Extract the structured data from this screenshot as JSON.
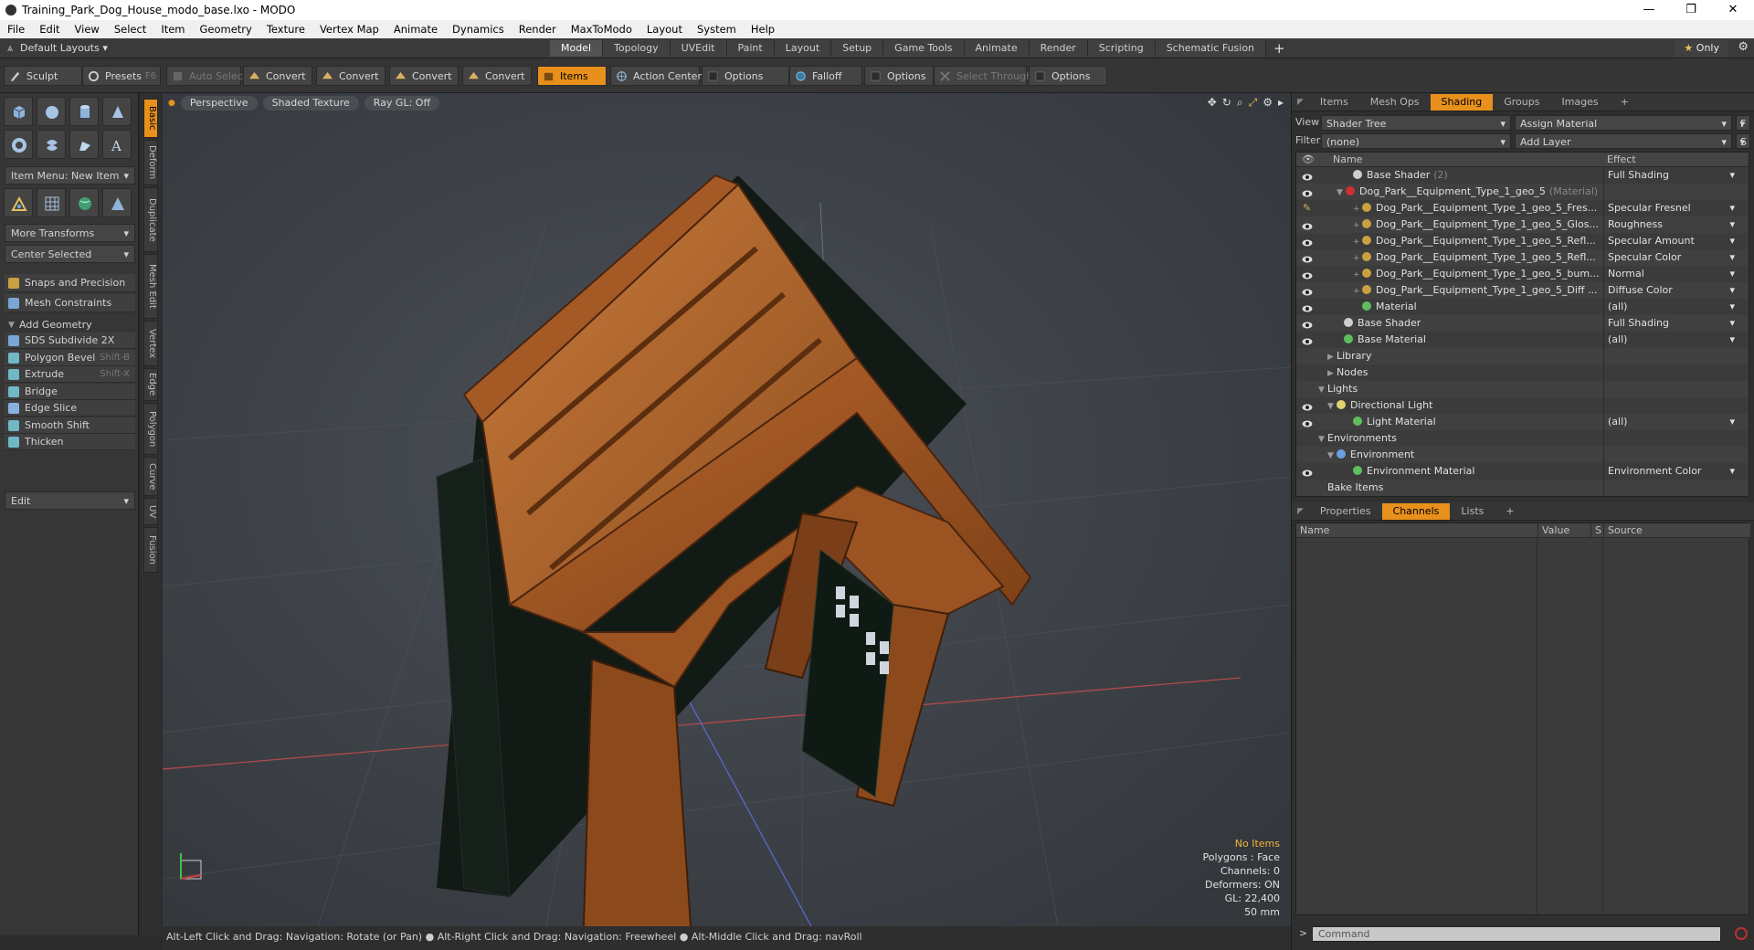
{
  "window": {
    "title": "Training_Park_Dog_House_modo_base.lxo - MODO",
    "controls": [
      "—",
      "❐",
      "✕"
    ]
  },
  "menu": [
    "File",
    "Edit",
    "View",
    "Select",
    "Item",
    "Geometry",
    "Texture",
    "Vertex Map",
    "Animate",
    "Dynamics",
    "Render",
    "MaxToModo",
    "Layout",
    "System",
    "Help"
  ],
  "layoutbar": {
    "layouts_label": "Default Layouts",
    "tabs": [
      "Model",
      "Topology",
      "UVEdit",
      "Paint",
      "Layout",
      "Setup",
      "Game Tools",
      "Animate",
      "Render",
      "Scripting",
      "Schematic Fusion"
    ],
    "active_tab": "Model",
    "add": "+",
    "only_label": "Only"
  },
  "toolbar": {
    "sculpt": "Sculpt",
    "presets": "Presets",
    "presets_key": "F6",
    "auto_select": "Auto Select",
    "convert1": "Convert",
    "convert2": "Convert",
    "convert3": "Convert",
    "convert4": "Convert",
    "items": "Items",
    "action_center": "Action Center",
    "options1": "Options",
    "falloff": "Falloff",
    "options2": "Options",
    "select_through": "Select Through",
    "options3": "Options"
  },
  "leftpanel": {
    "item_menu": "Item Menu: New Item",
    "more_transforms": "More Transforms",
    "center_selected": "Center Selected",
    "snaps": "Snaps and Precision",
    "mesh_constraints": "Mesh Constraints",
    "add_geometry": "Add Geometry",
    "tools": [
      {
        "label": "SDS Subdivide 2X",
        "shortcut": "",
        "color": "#7aa6d6"
      },
      {
        "label": "Polygon Bevel",
        "shortcut": "Shift-B",
        "color": "#6fb8c4"
      },
      {
        "label": "Extrude",
        "shortcut": "Shift-X",
        "color": "#6fb8c4"
      },
      {
        "label": "Bridge",
        "shortcut": "",
        "color": "#6fb8c4"
      },
      {
        "label": "Edge Slice",
        "shortcut": "",
        "color": "#8ab0e0"
      },
      {
        "label": "Smooth Shift",
        "shortcut": "",
        "color": "#6fb8c4"
      },
      {
        "label": "Thicken",
        "shortcut": "",
        "color": "#6fb8c4"
      }
    ],
    "edit": "Edit"
  },
  "vtabs": [
    "Basic",
    "Deform",
    "Duplicate",
    "Mesh Edit",
    "Vertex",
    "Edge",
    "Polygon",
    "Curve",
    "UV",
    "Fusion"
  ],
  "viewport": {
    "perspective": "Perspective",
    "shading": "Shaded Texture",
    "raygl": "Ray GL: Off",
    "hud": {
      "no_items": "No Items",
      "polygons": "Polygons : Face",
      "channels": "Channels: 0",
      "deformers": "Deformers: ON",
      "gl": "GL: 22,400",
      "mm": "50 mm"
    }
  },
  "statusbar": "Alt-Left Click and Drag: Navigation: Rotate (or Pan) ● Alt-Right Click and Drag: Navigation: Freewheel ● Alt-Middle Click and Drag: navRoll",
  "shading": {
    "tabs": [
      "Items",
      "Mesh Ops",
      "Shading",
      "Groups",
      "Images",
      "+"
    ],
    "active_tab": "Shading",
    "view_label": "View",
    "view_value": "Shader Tree",
    "assign": "Assign Material",
    "f_btn": "F",
    "filter_label": "Filter",
    "filter_value": "(none)",
    "add_layer": "Add Layer",
    "s_btn": "S",
    "col_name": "Name",
    "col_effect": "Effect",
    "rows": [
      {
        "indent": 52,
        "name": "Base Shader",
        "sub": "(2)",
        "effect": "Full Shading",
        "dot": "#cfcfcf",
        "tri": "",
        "eye": true
      },
      {
        "indent": 44,
        "name": "Dog_Park__Equipment_Type_1_geo_5",
        "sub": "(Material)",
        "effect": "",
        "dot": "#d03030",
        "tri": "▼",
        "eye": true
      },
      {
        "indent": 62,
        "name": "Dog_Park__Equipment_Type_1_geo_5_Fres...",
        "sub": "",
        "effect": "Specular Fresnel",
        "dot": "#caa040",
        "tri": "+",
        "eye": "brush"
      },
      {
        "indent": 62,
        "name": "Dog_Park__Equipment_Type_1_geo_5_Glos...",
        "sub": "",
        "effect": "Roughness",
        "dot": "#caa040",
        "tri": "+",
        "eye": true
      },
      {
        "indent": 62,
        "name": "Dog_Park__Equipment_Type_1_geo_5_Refl...",
        "sub": "",
        "effect": "Specular Amount",
        "dot": "#caa040",
        "tri": "+",
        "eye": true
      },
      {
        "indent": 62,
        "name": "Dog_Park__Equipment_Type_1_geo_5_Refl...",
        "sub": "",
        "effect": "Specular Color",
        "dot": "#caa040",
        "tri": "+",
        "eye": true
      },
      {
        "indent": 62,
        "name": "Dog_Park__Equipment_Type_1_geo_5_bum...",
        "sub": "",
        "effect": "Normal",
        "dot": "#caa040",
        "tri": "+",
        "eye": true
      },
      {
        "indent": 62,
        "name": "Dog_Park__Equipment_Type_1_geo_5_Diff ...",
        "sub": "",
        "effect": "Diffuse Color",
        "dot": "#caa040",
        "tri": "+",
        "eye": true
      },
      {
        "indent": 62,
        "name": "Material",
        "sub": "",
        "effect": "(all)",
        "dot": "#5fbf5f",
        "tri": "",
        "eye": true
      },
      {
        "indent": 42,
        "name": "Base Shader",
        "sub": "",
        "effect": "Full Shading",
        "dot": "#cfcfcf",
        "tri": "",
        "eye": true
      },
      {
        "indent": 42,
        "name": "Base Material",
        "sub": "",
        "effect": "(all)",
        "dot": "#5fbf5f",
        "tri": "",
        "eye": true
      },
      {
        "indent": 34,
        "name": "Library",
        "sub": "",
        "effect": "",
        "dot": "",
        "tri": "▶",
        "eye": false
      },
      {
        "indent": 34,
        "name": "Nodes",
        "sub": "",
        "effect": "",
        "dot": "",
        "tri": "▶",
        "eye": false
      },
      {
        "indent": 24,
        "name": "Lights",
        "sub": "",
        "effect": "",
        "dot": "",
        "tri": "▼",
        "eye": false
      },
      {
        "indent": 34,
        "name": "Directional Light",
        "sub": "",
        "effect": "",
        "dot": "#e0d070",
        "tri": "▼",
        "eye": true
      },
      {
        "indent": 52,
        "name": "Light Material",
        "sub": "",
        "effect": "(all)",
        "dot": "#5fbf5f",
        "tri": "",
        "eye": true
      },
      {
        "indent": 24,
        "name": "Environments",
        "sub": "",
        "effect": "",
        "dot": "",
        "tri": "▼",
        "eye": false
      },
      {
        "indent": 34,
        "name": "Environment",
        "sub": "",
        "effect": "",
        "dot": "#6aa0e0",
        "tri": "▼",
        "eye": false
      },
      {
        "indent": 52,
        "name": "Environment Material",
        "sub": "",
        "effect": "Environment Color",
        "dot": "#5fbf5f",
        "tri": "",
        "eye": true
      },
      {
        "indent": 24,
        "name": "Bake Items",
        "sub": "",
        "effect": "",
        "dot": "",
        "tri": "",
        "eye": false
      }
    ]
  },
  "channels": {
    "tabs": [
      "Properties",
      "Channels",
      "Lists",
      "+"
    ],
    "active_tab": "Channels",
    "cols": [
      "Name",
      "Value",
      "S",
      "Source"
    ]
  },
  "command": {
    "placeholder": "Command",
    "label": ">"
  }
}
